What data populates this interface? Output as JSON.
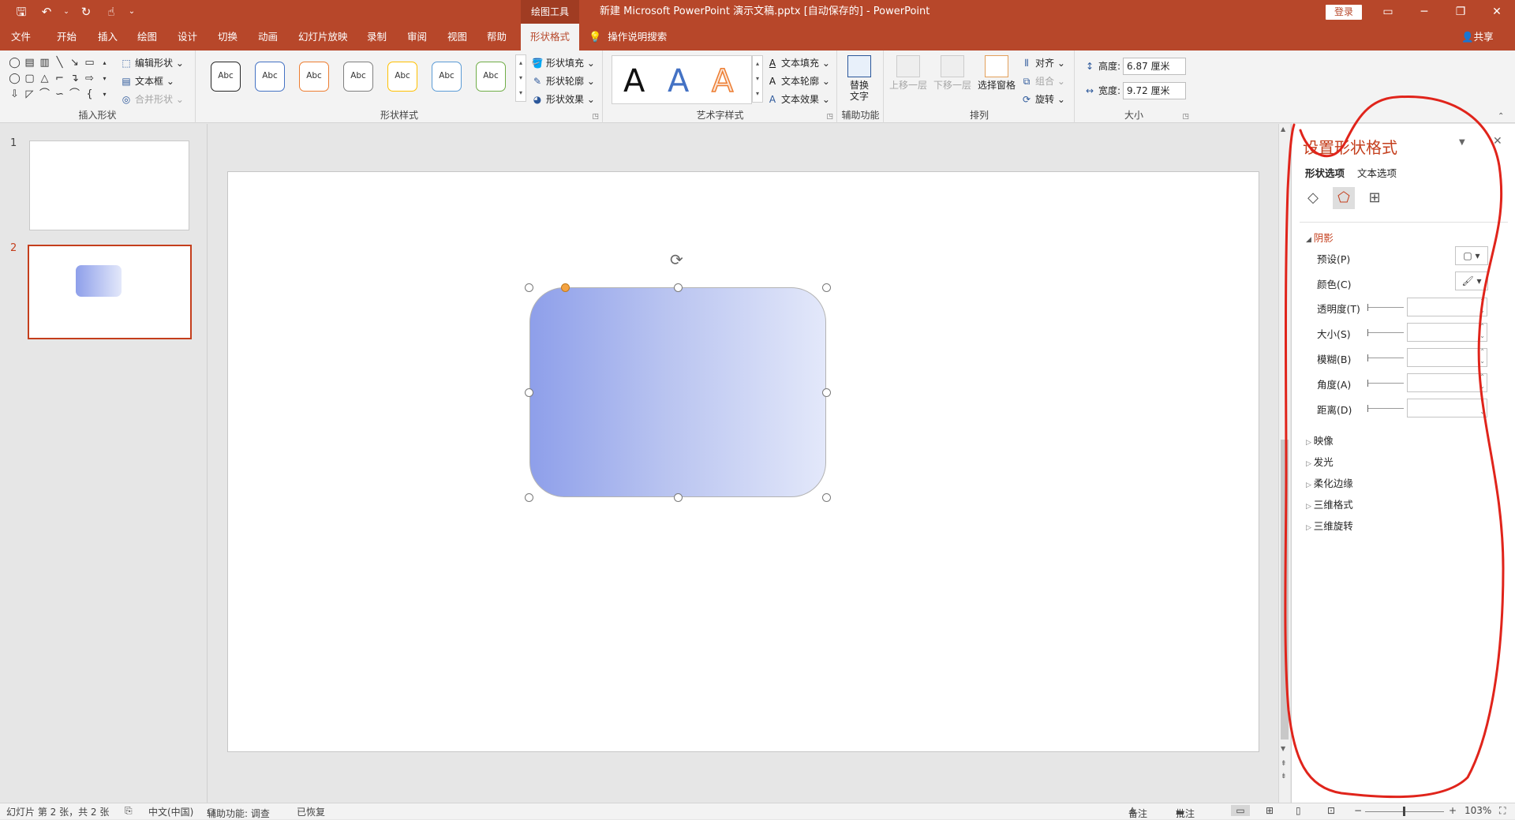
{
  "titlebar": {
    "context_tools": "绘图工具",
    "doc_title": "新建 Microsoft PowerPoint 演示文稿.pptx [自动保存的]  -  PowerPoint",
    "login": "登录"
  },
  "tabs": {
    "file": "文件",
    "home": "开始",
    "insert": "插入",
    "draw": "绘图",
    "design": "设计",
    "transitions": "切换",
    "animations": "动画",
    "slideshow": "幻灯片放映",
    "record": "录制",
    "review": "审阅",
    "view": "视图",
    "help": "帮助",
    "format": "形状格式",
    "tellme": "操作说明搜索",
    "share": "共享"
  },
  "ribbon": {
    "insert_shapes": {
      "label": "插入形状",
      "edit_shape": "编辑形状",
      "textbox": "文本框",
      "merge_shapes": "合并形状"
    },
    "shape_styles": {
      "label": "形状样式",
      "abc": "Abc",
      "fill": "形状填充",
      "outline": "形状轮廓",
      "effects": "形状效果",
      "preset_colors": [
        "#262626",
        "#4472c4",
        "#ed7d31",
        "#7f7f7f",
        "#ffc000",
        "#5b9bd5",
        "#70ad47"
      ]
    },
    "wordart": {
      "label": "艺术字样式",
      "a": "A",
      "text_fill": "文本填充",
      "text_outline": "文本轮廓",
      "text_effects": "文本效果"
    },
    "accessibility": {
      "label": "辅助功能",
      "alt_text_1": "替换",
      "alt_text_2": "文字"
    },
    "arrange": {
      "label": "排列",
      "bring_forward": "上移一层",
      "send_backward": "下移一层",
      "selection_pane": "选择窗格",
      "align": "对齐",
      "group": "组合",
      "rotate": "旋转"
    },
    "size": {
      "label": "大小",
      "height_label": "高度:",
      "height_value": "6.87 厘米",
      "width_label": "宽度:",
      "width_value": "9.72 厘米"
    }
  },
  "slides": {
    "items": [
      {
        "num": "1"
      },
      {
        "num": "2"
      }
    ]
  },
  "pane": {
    "title": "设置形状格式",
    "tab_shape": "形状选项",
    "tab_text": "文本选项",
    "shadow": {
      "header": "阴影",
      "preset": "预设(P)",
      "color": "颜色(C)",
      "transparency": "透明度(T)",
      "size": "大小(S)",
      "blur": "模糊(B)",
      "angle": "角度(A)",
      "distance": "距离(D)"
    },
    "sections": {
      "reflection": "映像",
      "glow": "发光",
      "soft_edges": "柔化边缘",
      "format3d": "三维格式",
      "rotation3d": "三维旋转"
    }
  },
  "status": {
    "slide_info": "幻灯片 第 2 张，共 2 张",
    "language": "中文(中国)",
    "accessibility": "辅助功能: 调查",
    "recovered": "已恢复",
    "notes": "备注",
    "comments": "批注",
    "zoom": "103%"
  }
}
